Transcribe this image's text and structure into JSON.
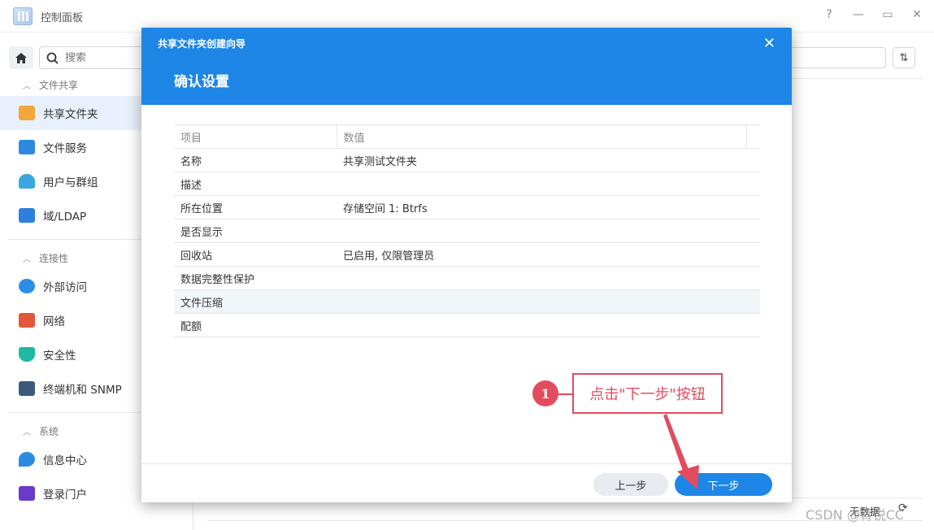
{
  "window": {
    "title": "控制面板",
    "controls": [
      "?",
      "—",
      "▭",
      "✕"
    ]
  },
  "sidebar": {
    "search_placeholder": "搜索",
    "sections": [
      {
        "header": "文件共享",
        "items": [
          {
            "label": "共享文件夹",
            "icon": "folder-share-icon",
            "color": "#f2a73b",
            "active": true
          },
          {
            "label": "文件服务",
            "icon": "file-service-icon",
            "color": "#2d8ae0",
            "active": false
          },
          {
            "label": "用户与群组",
            "icon": "users-icon",
            "color": "#3aa7e0",
            "active": false
          },
          {
            "label": "域/LDAP",
            "icon": "domain-icon",
            "color": "#2d7fe0",
            "active": false
          }
        ]
      },
      {
        "header": "连接性",
        "items": [
          {
            "label": "外部访问",
            "icon": "external-access-icon",
            "color": "#2a8ee8",
            "active": false
          },
          {
            "label": "网络",
            "icon": "network-house-icon",
            "color": "#e0583a",
            "active": false
          },
          {
            "label": "安全性",
            "icon": "shield-icon",
            "color": "#1fb8a0",
            "active": false
          },
          {
            "label": "终端机和 SNMP",
            "icon": "terminal-icon",
            "color": "#3b5a7a",
            "active": false
          }
        ]
      },
      {
        "header": "系统",
        "items": [
          {
            "label": "信息中心",
            "icon": "info-icon",
            "color": "#2d8ae0",
            "active": false
          },
          {
            "label": "登录门户",
            "icon": "login-portal-icon",
            "color": "#6a3ac9",
            "active": false
          }
        ]
      }
    ]
  },
  "dialog": {
    "title": "共享文件夹创建向导",
    "subtitle": "确认设置",
    "columns": [
      "项目",
      "数值"
    ],
    "rows": [
      {
        "item": "名称",
        "value": "共享测试文件夹"
      },
      {
        "item": "描述",
        "value": ""
      },
      {
        "item": "所在位置",
        "value": "存储空间 1:  Btrfs"
      },
      {
        "item": "是否显示",
        "value": ""
      },
      {
        "item": "回收站",
        "value": "已启用, 仅限管理员"
      },
      {
        "item": "数据完整性保护",
        "value": ""
      },
      {
        "item": "文件压缩",
        "value": ""
      },
      {
        "item": "配额",
        "value": ""
      }
    ],
    "prev_label": "上一步",
    "next_label": "下一步"
  },
  "annotation": {
    "step": "1",
    "text": "点击\"下一步\"按钮",
    "color": "#e34b5f"
  },
  "background": {
    "nodata": "无数据",
    "watermark": "CSDN @青锐CC"
  }
}
